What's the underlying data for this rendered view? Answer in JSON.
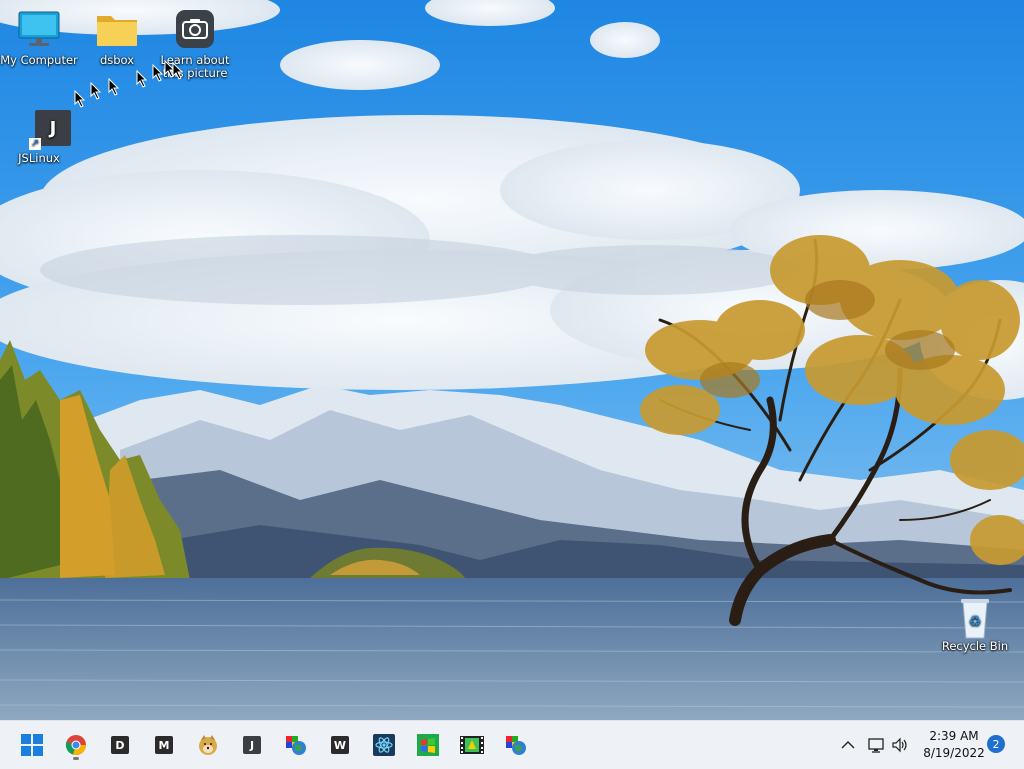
{
  "desktop": {
    "icons": {
      "my_computer": "My Computer",
      "dsbox": "dsbox",
      "learn_about": "Learn about this picture",
      "jslinux": "JSLinux",
      "recycle_bin": "Recycle Bin"
    },
    "jslinux_letter": "J"
  },
  "taskbar": {
    "apps": [
      {
        "name": "start-button-icon"
      },
      {
        "name": "chrome-icon"
      },
      {
        "name": "D",
        "letter": "D"
      },
      {
        "name": "M",
        "letter": "M"
      },
      {
        "name": "doge-icon"
      },
      {
        "name": "J",
        "letter": "J"
      },
      {
        "name": "globe-app-icon"
      },
      {
        "name": "W",
        "letter": "W"
      },
      {
        "name": "atom-icon"
      },
      {
        "name": "windows-flag-icon"
      },
      {
        "name": "film-icon"
      },
      {
        "name": "globe-app-icon-2"
      }
    ],
    "letters": {
      "d": "D",
      "m": "M",
      "j": "J",
      "w": "W"
    }
  },
  "tray": {
    "time": "2:39 AM",
    "date": "8/19/2022",
    "notifications": "2"
  },
  "colors": {
    "sky": "#2a93e6",
    "taskbar": "#eef1f6",
    "accent": "#1e6fd0"
  }
}
